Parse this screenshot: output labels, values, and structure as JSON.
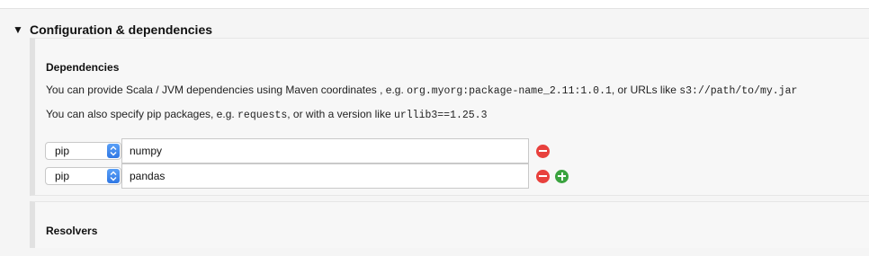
{
  "section": {
    "toggle_glyph": "▼",
    "title": "Configuration & dependencies"
  },
  "dependencies": {
    "title": "Dependencies",
    "line1": {
      "prefix": "You can provide Scala / JVM dependencies using Maven coordinates , e.g. ",
      "code1": "org.myorg:package-name_2.11:1.0.1",
      "middle": ", or URLs like ",
      "code2": "s3://path/to/my.jar"
    },
    "line2": {
      "prefix": "You can also specify pip packages, e.g. ",
      "code1": "requests",
      "middle": ", or with a version like ",
      "code2": "urllib3==1.25.3"
    },
    "rows": [
      {
        "type": "pip",
        "value": "numpy"
      },
      {
        "type": "pip",
        "value": "pandas"
      }
    ]
  },
  "resolvers": {
    "title": "Resolvers"
  },
  "colors": {
    "remove": "#e8413d",
    "add": "#3aa33f",
    "stepper": "#2f77e4"
  }
}
